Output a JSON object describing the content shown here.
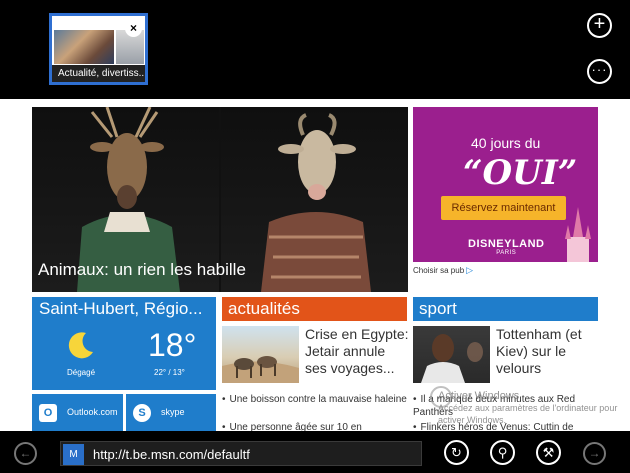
{
  "tabs": {
    "active_tab": {
      "title": "Actualité, divertiss...",
      "close_glyph": "×"
    },
    "new_tab_glyph": "+",
    "more_glyph": "···"
  },
  "page": {
    "hero": {
      "caption": "Animaux: un rien les habille"
    },
    "ad": {
      "line1": "40 jours du",
      "line2": "“OUI”",
      "button": "Réservez maintenant",
      "brand": "DISNEYLAND",
      "brand_sub": "PARIS",
      "note": "Choisir sa pub",
      "note_icon": "▷"
    },
    "weather": {
      "city": "Saint-Hubert, Régio...",
      "temperature": "18°",
      "condition": "Dégagé",
      "range": "22° / 13°"
    },
    "apps": {
      "outlook": {
        "label": "Outlook.com",
        "icon": "O"
      },
      "skype": {
        "label": "skype",
        "icon": "S"
      }
    },
    "news": {
      "heading": "actualités",
      "headline": "Crise en Egypte: Jetair annule ses voyages...",
      "bullets": [
        "Une boisson contre la mauvaise haleine",
        "Une personne âgée sur 10 en"
      ]
    },
    "sport": {
      "heading": "sport",
      "headline": "Tottenham (et Kiev) sur le velours",
      "bullets": [
        "Il a manqué deux minutes aux Red Panthers",
        "Flinkers héros de Venus: Cuttin de"
      ]
    },
    "watermark": {
      "title": "Activer Windows",
      "text": "Accédez aux paramètres de l'ordinateur pour activer Windows."
    }
  },
  "appbar": {
    "back_glyph": "←",
    "forward_glyph": "→",
    "site_icon": "M",
    "address": "http://t.be.msn.com/defaultf",
    "refresh_glyph": "↻",
    "pin_glyph": "⚲",
    "tools_glyph": "⚒"
  },
  "colors": {
    "accent_blue": "#1f7dcb",
    "news_orange": "#e25419",
    "ad_purple": "#9b1f8e",
    "ad_yellow": "#f6b42a"
  }
}
